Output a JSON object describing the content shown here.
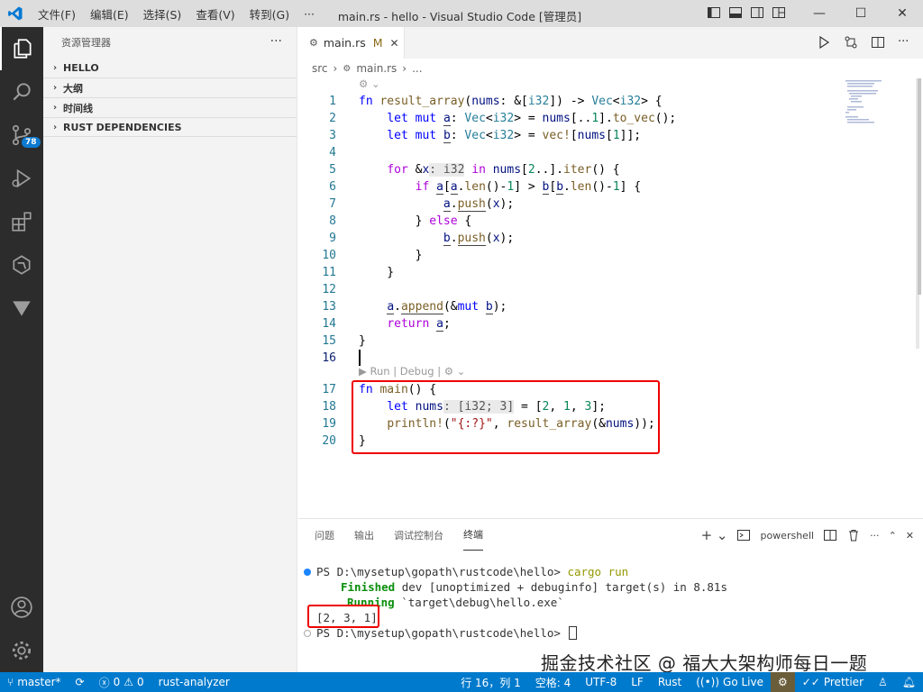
{
  "window": {
    "menus": [
      "文件(F)",
      "编辑(E)",
      "选择(S)",
      "查看(V)",
      "转到(G)",
      "···"
    ],
    "title": "main.rs - hello - Visual Studio Code [管理员]"
  },
  "activity": {
    "badge": "78"
  },
  "sidebar": {
    "title": "资源管理器",
    "more": "···",
    "sections": [
      "HELLO",
      "大纲",
      "时间线",
      "RUST DEPENDENCIES"
    ]
  },
  "tab": {
    "name": "main.rs",
    "modified": "M"
  },
  "breadcrumb": {
    "folder": "src",
    "file": "main.rs",
    "more": "..."
  },
  "editor": {
    "codelens_main": "▶ Run | Debug |",
    "line_numbers": [
      "1",
      "2",
      "3",
      "4",
      "5",
      "6",
      "7",
      "8",
      "9",
      "10",
      "11",
      "12",
      "13",
      "14",
      "15",
      "16",
      "17",
      "18",
      "19",
      "20"
    ]
  },
  "panel": {
    "tabs": [
      "问题",
      "输出",
      "调试控制台",
      "终端"
    ],
    "shell": "powershell",
    "terminal": {
      "prompt1": "PS D:\\mysetup\\gopath\\rustcode\\hello> ",
      "cmd": "cargo run",
      "finished_label": "Finished",
      "finished_text": " dev [unoptimized + debuginfo] target(s) in 8.81s",
      "running_label": "Running",
      "running_text": " `target\\debug\\hello.exe`",
      "output": "[2, 3, 1]",
      "prompt2": "PS D:\\mysetup\\gopath\\rustcode\\hello> "
    }
  },
  "watermark": "掘金技术社区 @ 福大大架构师每日一题",
  "status": {
    "branch": "master*",
    "errors": "0",
    "warnings": "0",
    "analyzer": "rust-analyzer",
    "position": "行 16，列 1",
    "spaces": "空格: 4",
    "encoding": "UTF-8",
    "eol": "LF",
    "language": "Rust",
    "golive": "Go Live",
    "prettier": "Prettier"
  },
  "colors": {
    "accent": "#007acc",
    "activity_bg": "#2c2c2c",
    "highlight_box": "#ee0000"
  }
}
